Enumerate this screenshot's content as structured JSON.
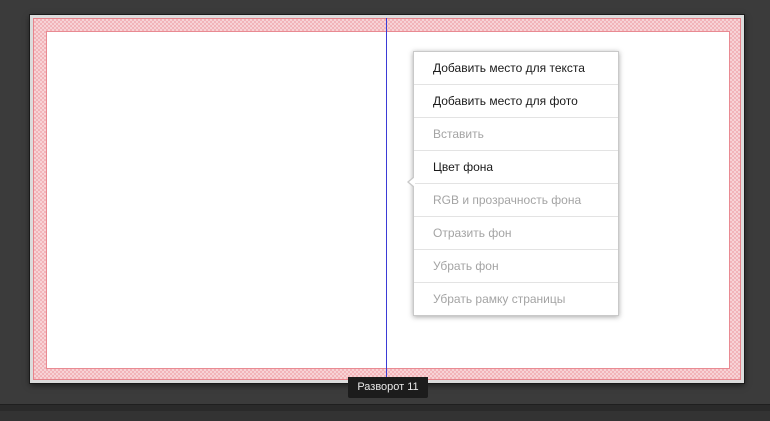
{
  "context_menu": {
    "items": [
      {
        "label": "Добавить место для текста",
        "enabled": true
      },
      {
        "label": "Добавить место для фото",
        "enabled": true
      },
      {
        "label": "Вставить",
        "enabled": false
      },
      {
        "label": "Цвет фона",
        "enabled": true
      },
      {
        "label": "RGB и прозрачность фона",
        "enabled": false
      },
      {
        "label": "Отразить фон",
        "enabled": false
      },
      {
        "label": "Убрать фон",
        "enabled": false
      },
      {
        "label": "Убрать рамку страницы",
        "enabled": false
      }
    ]
  },
  "spread": {
    "label": "Разворот 11"
  },
  "colors": {
    "workspace_bg": "#3b3b3b",
    "bleed_pink": "#f2b4b9",
    "bleed_border": "#e7838b",
    "spine_line": "#3b3bd6",
    "label_bg": "#1c1c1c",
    "menu_text": "#1a1a1a",
    "menu_text_disabled": "#a4a4a4"
  }
}
